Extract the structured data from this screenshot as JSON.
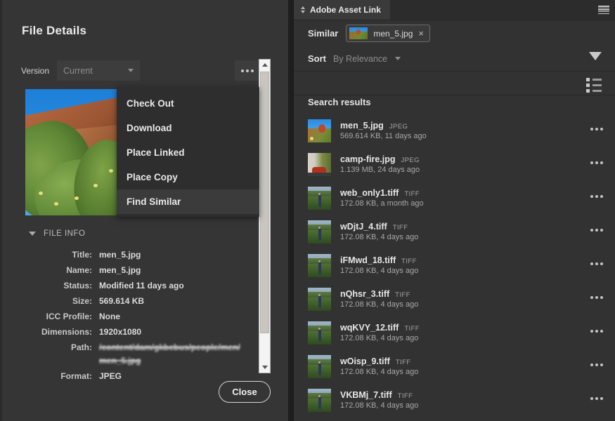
{
  "left_dialog": {
    "title": "File Details",
    "version": {
      "label": "Version",
      "value": "Current"
    },
    "more_button": "more-options",
    "context_menu": {
      "items": [
        {
          "label": "Check Out",
          "selected": false
        },
        {
          "label": "Download",
          "selected": false
        },
        {
          "label": "Place Linked",
          "selected": false
        },
        {
          "label": "Place Copy",
          "selected": false
        },
        {
          "label": "Find Similar",
          "selected": true
        }
      ]
    },
    "file_info": {
      "section_title": "FILE INFO",
      "rows": [
        {
          "key": "Title:",
          "value": "men_5.jpg",
          "redacted": false
        },
        {
          "key": "Name:",
          "value": "men_5.jpg",
          "redacted": false
        },
        {
          "key": "Status:",
          "value": "Modified 11 days ago",
          "redacted": false
        },
        {
          "key": "Size:",
          "value": "569.614 KB",
          "redacted": false
        },
        {
          "key": "ICC Profile:",
          "value": "None",
          "redacted": false
        },
        {
          "key": "Dimensions:",
          "value": "1920x1080",
          "redacted": false
        },
        {
          "key": "Path:",
          "value": "/content/dam/gkbcbus/people/men/men_5.jpg",
          "redacted": true
        },
        {
          "key": "Format:",
          "value": "JPEG",
          "redacted": false
        }
      ]
    },
    "close_button": "Close"
  },
  "right_panel": {
    "tab": {
      "label": "Adobe Asset Link"
    },
    "similar": {
      "label": "Similar",
      "chip_label": "men_5.jpg",
      "chip_close": "×"
    },
    "sort": {
      "label": "Sort",
      "value": "By Relevance"
    },
    "results_title": "Search results",
    "results": [
      {
        "name": "men_5.jpg",
        "type": "JPEG",
        "meta": "569.614 KB, 11 days ago",
        "art": "t-men"
      },
      {
        "name": "camp-fire.jpg",
        "type": "JPEG",
        "meta": "1.139 MB, 24 days ago",
        "art": "t-fire"
      },
      {
        "name": "web_only1.tiff",
        "type": "TIFF",
        "meta": "172.08 KB, a month ago",
        "art": "t-field"
      },
      {
        "name": "wDjtJ_4.tiff",
        "type": "TIFF",
        "meta": "172.08 KB, 4 days ago",
        "art": "t-field"
      },
      {
        "name": "iFMwd_18.tiff",
        "type": "TIFF",
        "meta": "172.08 KB, 4 days ago",
        "art": "t-field"
      },
      {
        "name": "nQhsr_3.tiff",
        "type": "TIFF",
        "meta": "172.08 KB, 4 days ago",
        "art": "t-field"
      },
      {
        "name": "wqKVY_12.tiff",
        "type": "TIFF",
        "meta": "172.08 KB, 4 days ago",
        "art": "t-field"
      },
      {
        "name": "wOisp_9.tiff",
        "type": "TIFF",
        "meta": "172.08 KB, 4 days ago",
        "art": "t-field"
      },
      {
        "name": "VKBMj_7.tiff",
        "type": "TIFF",
        "meta": "172.08 KB, 4 days ago",
        "art": "t-field"
      }
    ]
  },
  "colors": {
    "panel_bg": "#353535",
    "right_bg": "#323232",
    "menu_bg": "#2e2e2e",
    "menu_selected": "#3b3b3b",
    "text": "#e8e8e8",
    "muted": "#a8a8a8"
  }
}
